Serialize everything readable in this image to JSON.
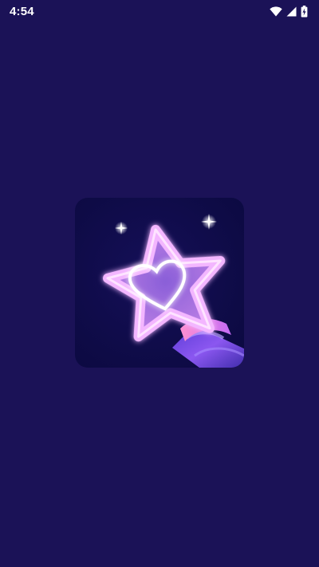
{
  "status_bar": {
    "time": "4:54",
    "icons": [
      "wifi-icon",
      "cellular-signal-icon",
      "battery-charging-icon"
    ],
    "text_color": "#ffffff"
  },
  "splash": {
    "background_color": "#1b1257",
    "logo": {
      "icon": "star-wand-heart-icon",
      "tile_color": "#0e0b46",
      "glow_color": "#f3b6ff",
      "handle_color": "#7a45e6"
    }
  }
}
